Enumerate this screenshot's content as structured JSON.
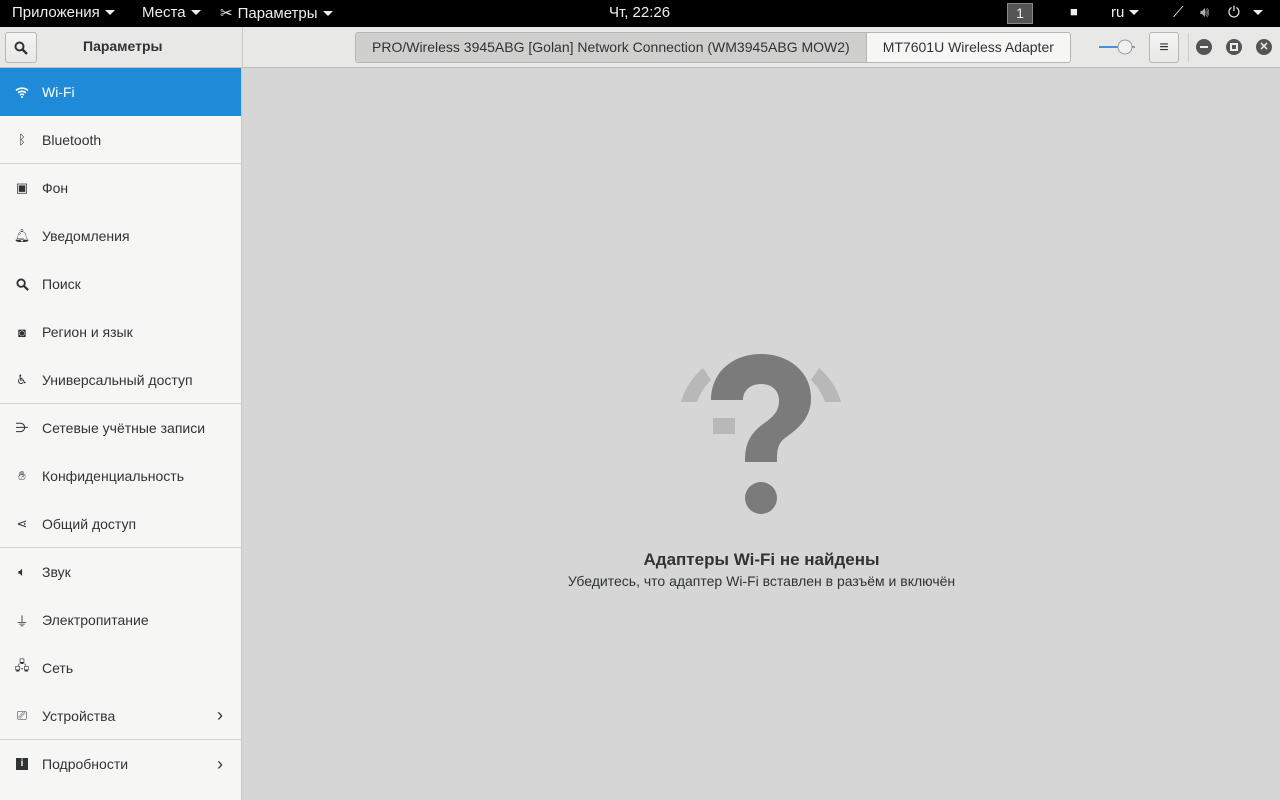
{
  "topbar": {
    "apps": "Приложения",
    "places": "Места",
    "app_menu": "Параметры",
    "clock": "Чт, 22:26",
    "workspace": "1",
    "lang": "ru"
  },
  "header": {
    "title": "Параметры",
    "tabs": [
      {
        "label": "PRO/Wireless 3945ABG [Golan] Network Connection (WM3945ABG MOW2)",
        "active": true
      },
      {
        "label": "MT7601U Wireless Adapter",
        "active": false
      }
    ],
    "wifi_switch_on": true,
    "accent": "#1f8ad8"
  },
  "sidebar": {
    "items": [
      {
        "label": "Wi-Fi",
        "icon": "wifi-icon"
      },
      {
        "label": "Bluetooth",
        "icon": "bluetooth-icon"
      },
      {
        "label": "Фон",
        "icon": "background-icon"
      },
      {
        "label": "Уведомления",
        "icon": "bell-icon"
      },
      {
        "label": "Поиск",
        "icon": "search-icon"
      },
      {
        "label": "Регион и язык",
        "icon": "region-icon"
      },
      {
        "label": "Универсальный доступ",
        "icon": "accessibility-icon"
      },
      {
        "label": "Сетевые учётные записи",
        "icon": "online-accounts-icon"
      },
      {
        "label": "Конфиденциальность",
        "icon": "privacy-hand-icon"
      },
      {
        "label": "Общий доступ",
        "icon": "share-icon"
      },
      {
        "label": "Звук",
        "icon": "speaker-icon"
      },
      {
        "label": "Электропитание",
        "icon": "power-plug-icon"
      },
      {
        "label": "Сеть",
        "icon": "network-icon"
      },
      {
        "label": "Устройства",
        "icon": "devices-icon"
      },
      {
        "label": "Подробности",
        "icon": "info-icon"
      }
    ]
  },
  "main": {
    "empty_title": "Адаптеры Wi-Fi не найдены",
    "empty_subtitle": "Убедитесь, что адаптер Wi-Fi вставлен в разъём и включён"
  }
}
